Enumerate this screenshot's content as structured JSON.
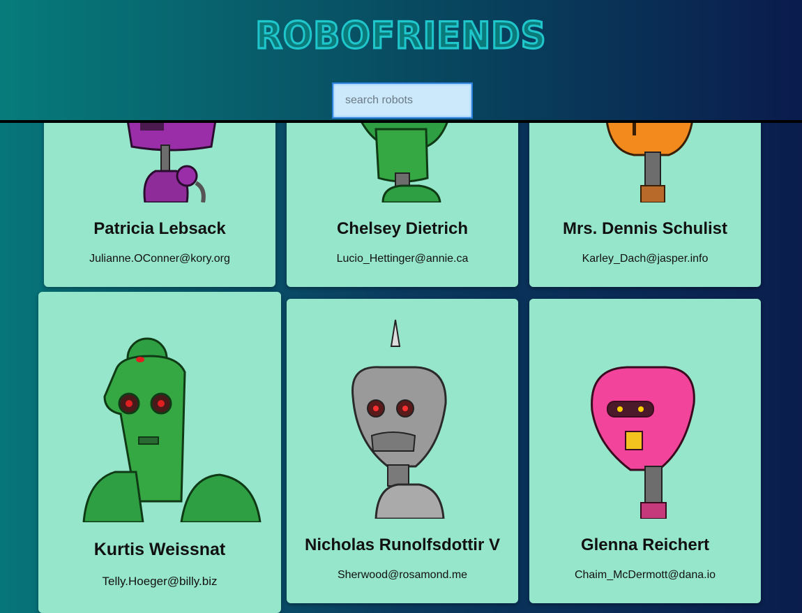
{
  "app": {
    "title": "ROBOFRIENDS"
  },
  "search": {
    "placeholder": "search robots",
    "value": ""
  },
  "robots": [
    {
      "name": "Patricia Lebsack",
      "email": "Julianne.OConner@kory.org",
      "color": "#8e2c9a"
    },
    {
      "name": "Chelsey Dietrich",
      "email": "Lucio_Hettinger@annie.ca",
      "color": "#2ea043"
    },
    {
      "name": "Mrs. Dennis Schulist",
      "email": "Karley_Dach@jasper.info",
      "color": "#f28a1e"
    },
    {
      "name": "Kurtis Weissnat",
      "email": "Telly.Hoeger@billy.biz",
      "color": "#2ea43a"
    },
    {
      "name": "Nicholas Runolfsdottir V",
      "email": "Sherwood@rosamond.me",
      "color": "#9a9a9a"
    },
    {
      "name": "Glenna Reichert",
      "email": "Chaim_McDermott@dana.io",
      "color": "#f2449a"
    }
  ]
}
